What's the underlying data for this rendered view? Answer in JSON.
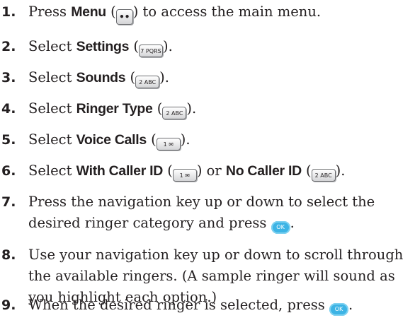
{
  "steps": [
    {
      "num": "1.",
      "pre": "Press ",
      "kw": "Menu",
      "open": " (",
      "key": "••",
      "close": ") to access the main menu."
    },
    {
      "num": "2.",
      "pre": "Select ",
      "kw": "Settings",
      "open": " (",
      "key": "7 PQRS",
      "close": ")."
    },
    {
      "num": "3.",
      "pre": "Select ",
      "kw": "Sounds",
      "open": " (",
      "key": "2 ABC",
      "close": ")."
    },
    {
      "num": "4.",
      "pre": "Select ",
      "kw": "Ringer Type",
      "open": " (",
      "key": "2 ABC",
      "close": ")."
    },
    {
      "num": "5.",
      "pre": "Select ",
      "kw": "Voice Calls",
      "open": " (",
      "key": "1 ✉",
      "close": ")."
    },
    {
      "num": "6.",
      "pre": "Select ",
      "kw": "With Caller ID",
      "open": " (",
      "key": "1 ✉",
      "mid": ") or ",
      "kw2": "No Caller ID",
      "open2": " (",
      "key2": "2 ABC",
      "close": ")."
    },
    {
      "num": "7.",
      "line1": "Press the navigation key up or down to select the",
      "line2": "desired ringer category and press ",
      "ok": "OK",
      "close": "."
    },
    {
      "num": "8.",
      "line1": "Use your navigation key up or down to scroll through",
      "line2": "the available ringers. (A sample ringer will sound as",
      "line3": "you highlight each option.)"
    },
    {
      "num": "9.",
      "line1": "When the desired ringer is selected, press ",
      "ok": "OK",
      "close": "."
    }
  ]
}
